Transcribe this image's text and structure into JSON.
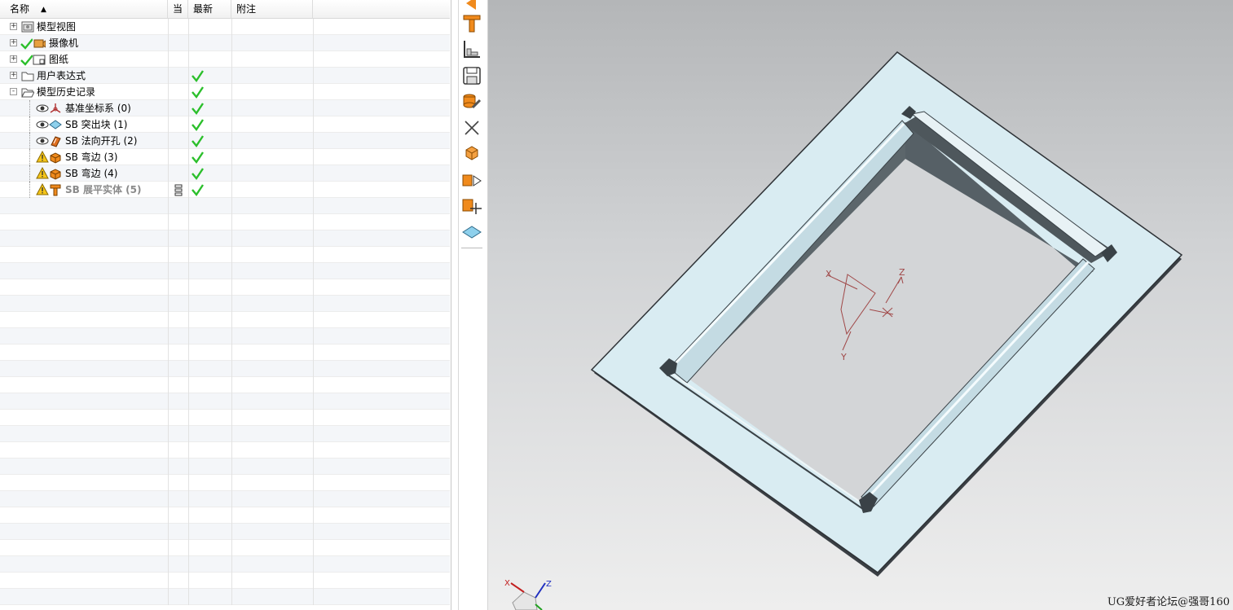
{
  "navigator": {
    "columns": {
      "name": "名称",
      "current": "当",
      "latest": "最新",
      "notes": "附注"
    },
    "rows": [
      {
        "label": "模型视图",
        "expander": "+",
        "check_prefix": false,
        "icon": "model-views-icon",
        "latest": false,
        "current": ""
      },
      {
        "label": "摄像机",
        "expander": "+",
        "check_prefix": true,
        "icon": "camera-icon",
        "latest": false,
        "current": ""
      },
      {
        "label": "图纸",
        "expander": "+",
        "check_prefix": true,
        "icon": "drawing-icon",
        "latest": false,
        "current": ""
      },
      {
        "label": "用户表达式",
        "expander": "+",
        "check_prefix": false,
        "icon": "folder-icon",
        "latest": true,
        "current": ""
      },
      {
        "label": "模型历史记录",
        "expander": "-",
        "check_prefix": false,
        "icon": "folder-open-icon",
        "latest": true,
        "current": ""
      },
      {
        "label": "基准坐标系 (0)",
        "expander": "",
        "check_prefix": false,
        "icon": "datum-csys-icon",
        "visibility": "eye-icon",
        "latest": true,
        "current": ""
      },
      {
        "label": "SB 突出块 (1)",
        "expander": "",
        "check_prefix": false,
        "icon": "tab-feature-icon",
        "visibility": "eye-icon",
        "latest": true,
        "current": ""
      },
      {
        "label": "SB 法向开孔 (2)",
        "expander": "",
        "check_prefix": false,
        "icon": "normal-cutout-icon",
        "visibility": "eye-icon",
        "latest": true,
        "current": ""
      },
      {
        "label": "SB 弯边 (3)",
        "expander": "",
        "check_prefix": false,
        "icon": "flange-icon",
        "visibility": "warning-icon",
        "latest": true,
        "current": ""
      },
      {
        "label": "SB 弯边 (4)",
        "expander": "",
        "check_prefix": false,
        "icon": "flange-icon",
        "visibility": "warning-icon",
        "latest": true,
        "current": ""
      },
      {
        "label": "SB 展平实体 (5)",
        "expander": "",
        "check_prefix": false,
        "icon": "flat-solid-icon",
        "visibility": "warning-icon",
        "latest": true,
        "current": "timestamp-icon",
        "dimmed": true
      }
    ]
  },
  "toolbar": {
    "tools": [
      "orange-arrow-icon",
      "flat-solid-tool-icon",
      "corner-tool-icon",
      "save-icon",
      "database-wrench-icon",
      "close-x-icon",
      "cube-stack-icon",
      "cube-mirror-icon",
      "cube-move-icon",
      "plate-icon"
    ]
  },
  "viewport": {
    "axis_labels": {
      "x": "X",
      "y": "Y",
      "z": "Z"
    },
    "watermark": "UG爱好者论坛@强哥160"
  },
  "colors": {
    "check": "#2bbf2b",
    "plate": "#d9ecf2",
    "edge": "#3a3f44",
    "wall": "#5a6266",
    "csys": "#a04848",
    "triad_x": "#c22020",
    "triad_z": "#2030c0"
  }
}
